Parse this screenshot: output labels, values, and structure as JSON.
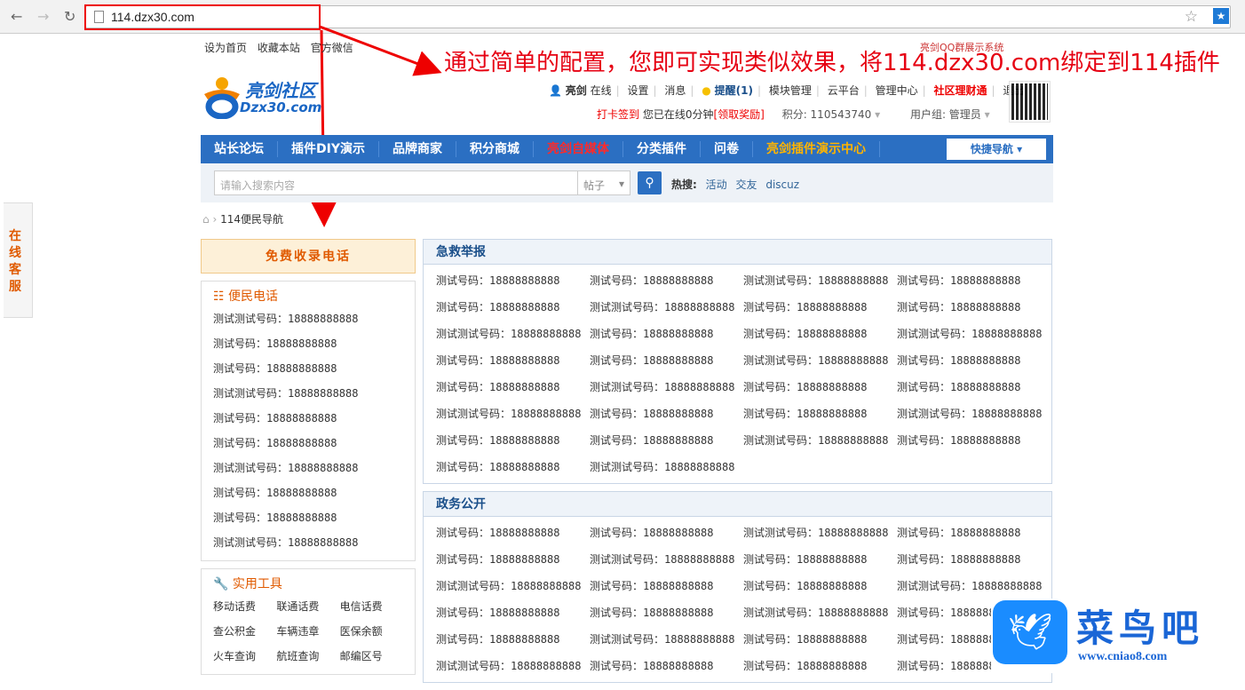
{
  "browser": {
    "url": "114.dzx30.com"
  },
  "toplinks": [
    "设为首页",
    "收藏本站",
    "官方微信"
  ],
  "qq_group": "亮剑QQ群展示系统",
  "annotation": "通过简单的配置，您即可实现类似效果，将114.dzx30.com绑定到114插件",
  "logo": {
    "name": "亮剑社区",
    "domain": "Dzx30.com"
  },
  "userbar": {
    "user": "亮剑",
    "online": "在线",
    "links": [
      "设置",
      "消息",
      "提醒(1)",
      "模块管理",
      "云平台",
      "管理中心",
      "社区理财通",
      "退出"
    ],
    "checkin": "打卡签到",
    "online_time": "您已在线0分钟",
    "reward": "[领取奖励]",
    "points": "积分: 110543740",
    "group": "用户组: 管理员"
  },
  "nav": {
    "items": [
      "站长论坛",
      "插件DIY演示",
      "品牌商家",
      "积分商城",
      "亮剑自媒体",
      "分类插件",
      "问卷",
      "亮剑插件演示中心"
    ],
    "quick": "快捷导航 ▾"
  },
  "search": {
    "placeholder": "请输入搜索内容",
    "type": "帖子",
    "hot_label": "热搜:",
    "hot": [
      "活动",
      "交友",
      "discuz"
    ]
  },
  "breadcrumb": "114便民导航",
  "side_service": "在线客服",
  "left": {
    "free_btn": "免费收录电话",
    "phones_title": "便民电话",
    "phones": [
      "测试测试号码：18888888888",
      "测试号码：18888888888",
      "测试号码：18888888888",
      "测试测试号码：18888888888",
      "测试号码：18888888888",
      "测试号码：18888888888",
      "测试测试号码：18888888888",
      "测试号码：18888888888",
      "测试号码：18888888888",
      "测试测试号码：18888888888"
    ],
    "tools_title": "实用工具",
    "tools": [
      "移动话费",
      "联通话费",
      "电信话费",
      "查公积金",
      "车辆违章",
      "医保余额",
      "火车查询",
      "航班查询",
      "邮编区号"
    ]
  },
  "panels": [
    {
      "title": "急救举报",
      "items": [
        "测试号码：18888888888",
        "测试号码：18888888888",
        "测试测试号码：18888888888",
        "测试号码：18888888888",
        "测试号码：18888888888",
        "测试测试号码：18888888888",
        "测试号码：18888888888",
        "测试号码：18888888888",
        "测试测试号码：18888888888",
        "测试号码：18888888888",
        "测试号码：18888888888",
        "测试测试号码：18888888888",
        "测试号码：18888888888",
        "测试号码：18888888888",
        "测试测试号码：18888888888",
        "测试号码：18888888888",
        "测试号码：18888888888",
        "测试测试号码：18888888888",
        "测试号码：18888888888",
        "测试号码：18888888888",
        "测试测试号码：18888888888",
        "测试号码：18888888888",
        "测试号码：18888888888",
        "测试测试号码：18888888888",
        "测试号码：18888888888",
        "测试号码：18888888888",
        "测试测试号码：18888888888",
        "测试号码：18888888888",
        "测试号码：18888888888",
        "测试测试号码：18888888888"
      ]
    },
    {
      "title": "政务公开",
      "items": [
        "测试号码：18888888888",
        "测试号码：18888888888",
        "测试测试号码：18888888888",
        "测试号码：18888888888",
        "测试号码：18888888888",
        "测试测试号码：18888888888",
        "测试号码：18888888888",
        "测试号码：18888888888",
        "测试测试号码：18888888888",
        "测试号码：18888888888",
        "测试号码：18888888888",
        "测试测试号码：18888888888",
        "测试号码：18888888888",
        "测试号码：18888888888",
        "测试测试号码：18888888888",
        "测试号码：18888888888",
        "测试号码：18888888888",
        "测试测试号码：18888888888",
        "测试号码：18888888888",
        "测试号码：18888888888",
        "测试测试号码：18888888888",
        "测试号码：18888888888",
        "测试号码：18888888888",
        "测试号码：18888888888"
      ]
    }
  ],
  "watermark": {
    "name": "菜鸟吧",
    "url": "www.cniao8.com"
  },
  "colors": {
    "nav": "#2b6fc2",
    "accent": "#e05a00",
    "annotation": "#e60012"
  }
}
